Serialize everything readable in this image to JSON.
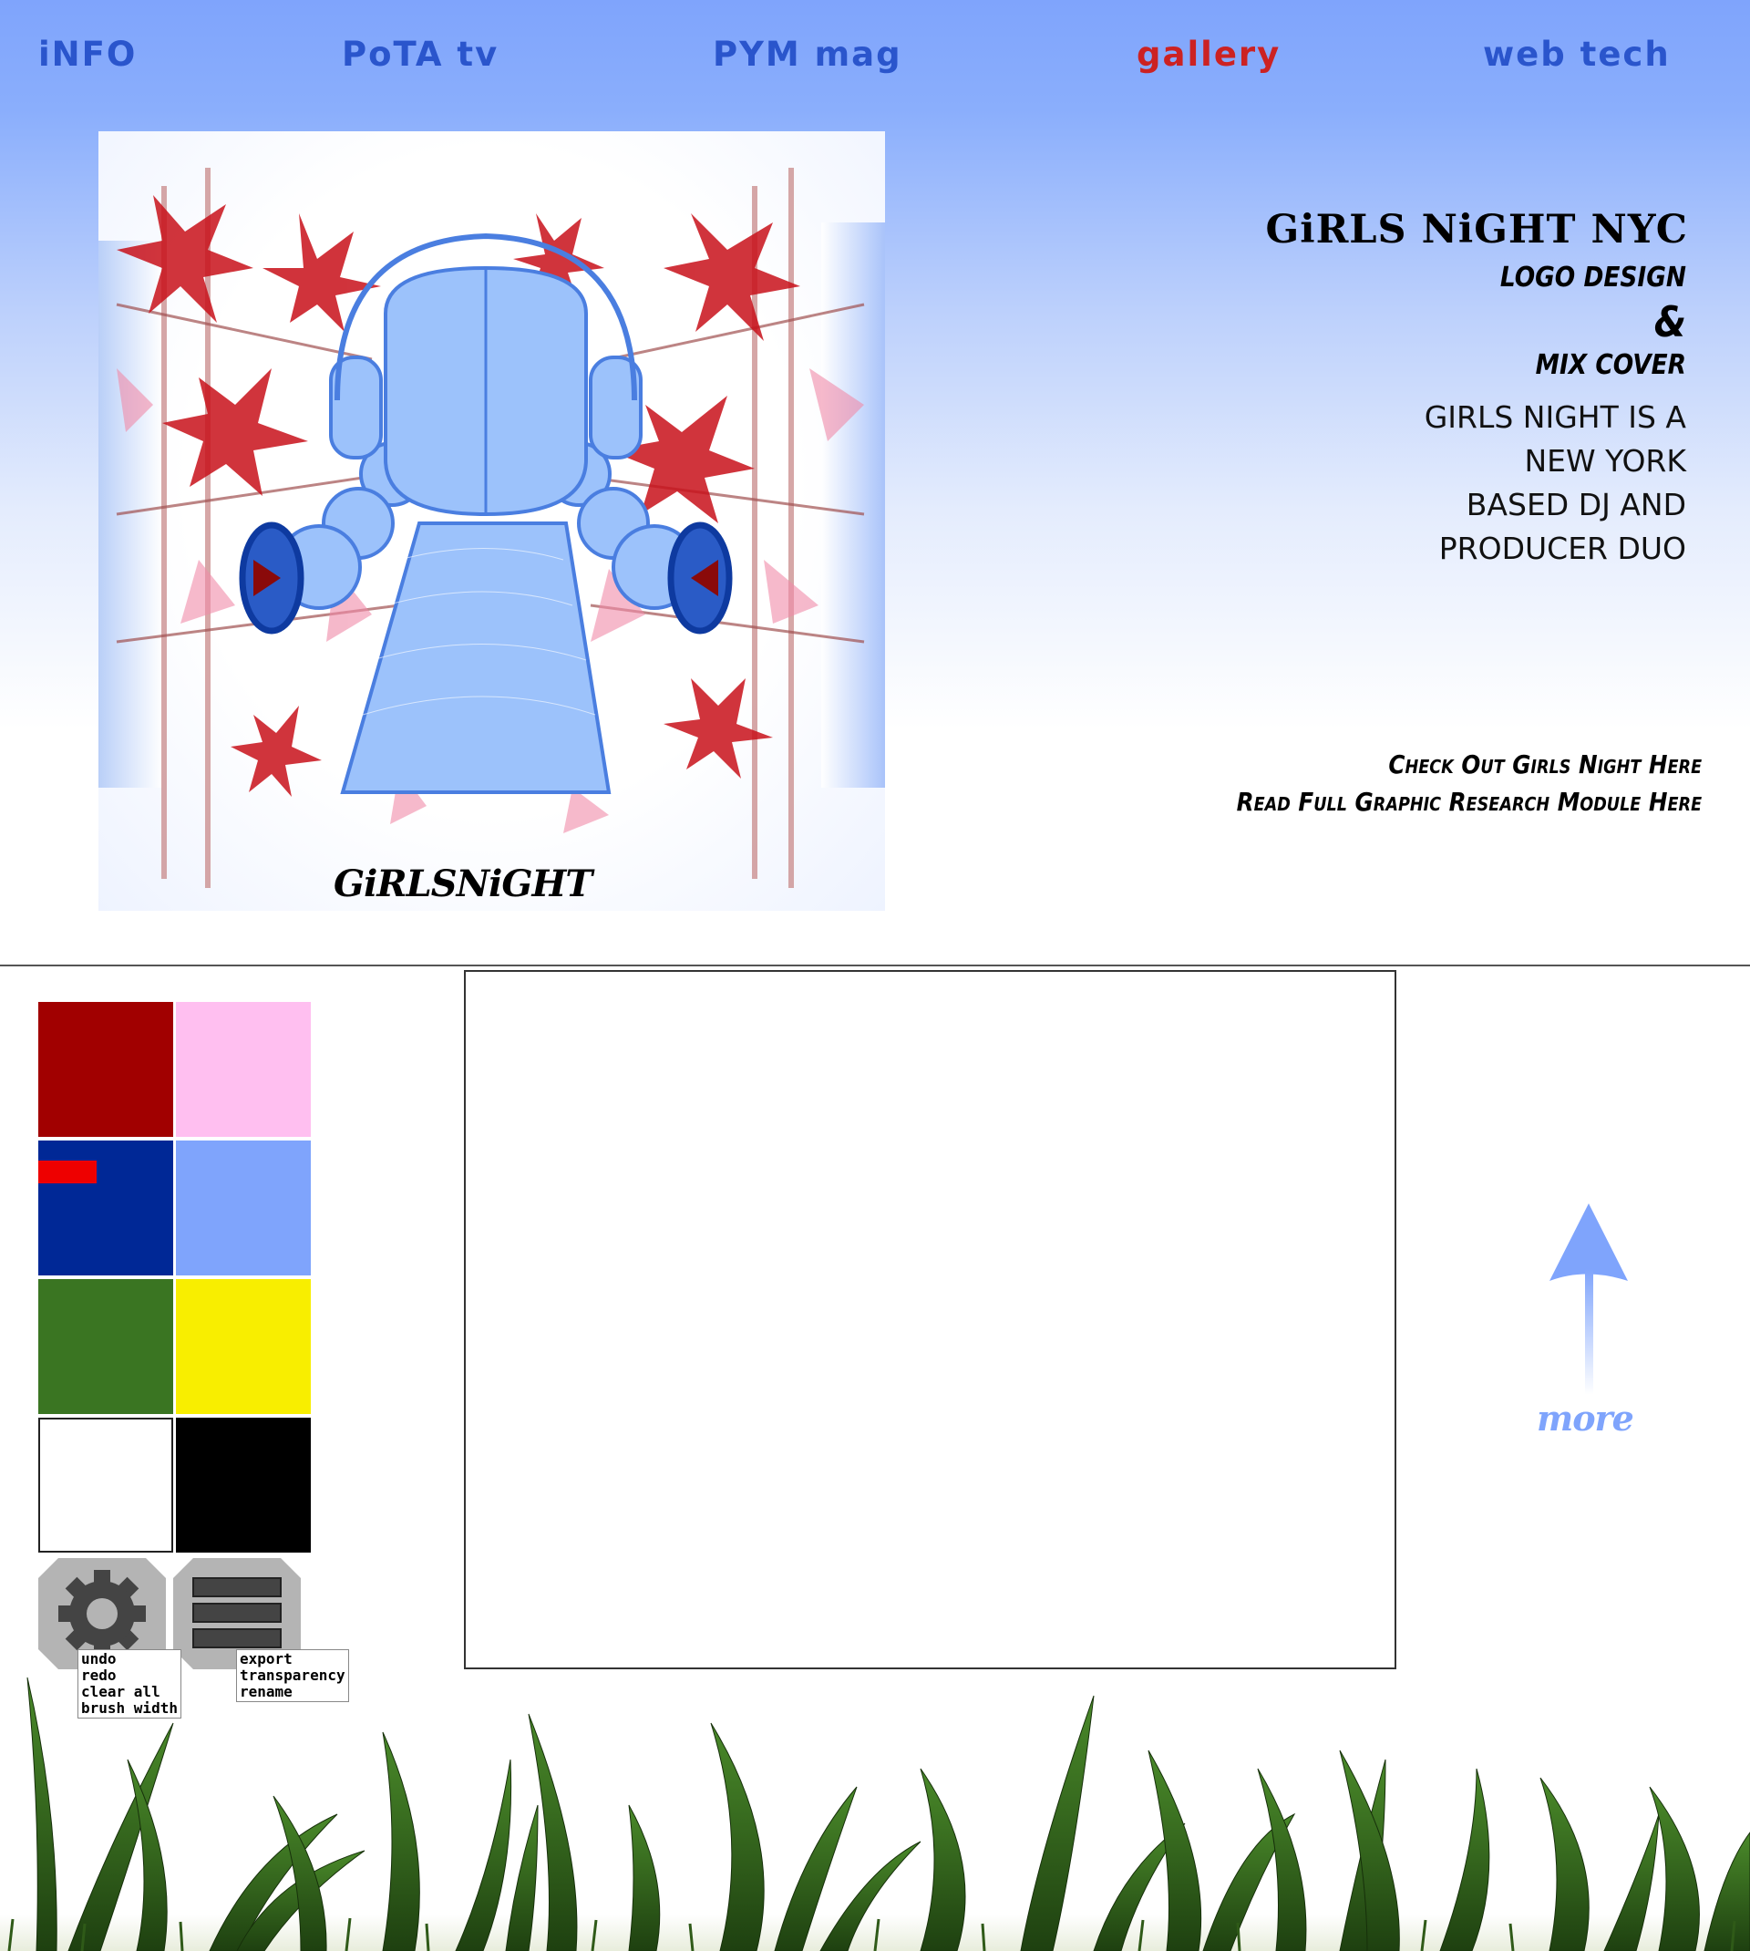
{
  "nav": {
    "items": [
      {
        "label": "iNFO",
        "active": false
      },
      {
        "label": "PoTA tv",
        "active": false
      },
      {
        "label": "PYM mag",
        "active": false
      },
      {
        "label": "gallery",
        "active": true
      },
      {
        "label": "web tech",
        "active": false
      }
    ]
  },
  "feature": {
    "artwork_logo_text": "GiRLSNiGHT",
    "title": "GiRLS NiGHT NYC",
    "subtitle_1": "LOGO DESIGN",
    "subtitle_amp": "&",
    "subtitle_2": "MIX COVER",
    "body_lines": [
      "GIRLS NIGHT IS A",
      "NEW YORK",
      "BASED DJ AND",
      "PRODUCER DUO"
    ],
    "link_1": "Check Out Girls Night Here",
    "link_2": "Read Full Graphic Research Module Here"
  },
  "paint": {
    "swatches": [
      "#a10000",
      "#ffbff0",
      "#002896",
      "#7fa4fc",
      "#3a7522",
      "#f8ee00",
      "#ffffff",
      "#000000"
    ],
    "selected_color": "#002896",
    "settings_menu": [
      "undo",
      "redo",
      "clear all",
      "brush width"
    ],
    "file_menu": [
      "export",
      "transparency",
      "rename"
    ],
    "more_label": "more"
  },
  "colors": {
    "nav_link": "#2a55cc",
    "nav_active": "#cc2222",
    "accent_blue": "#7fa4fc"
  }
}
